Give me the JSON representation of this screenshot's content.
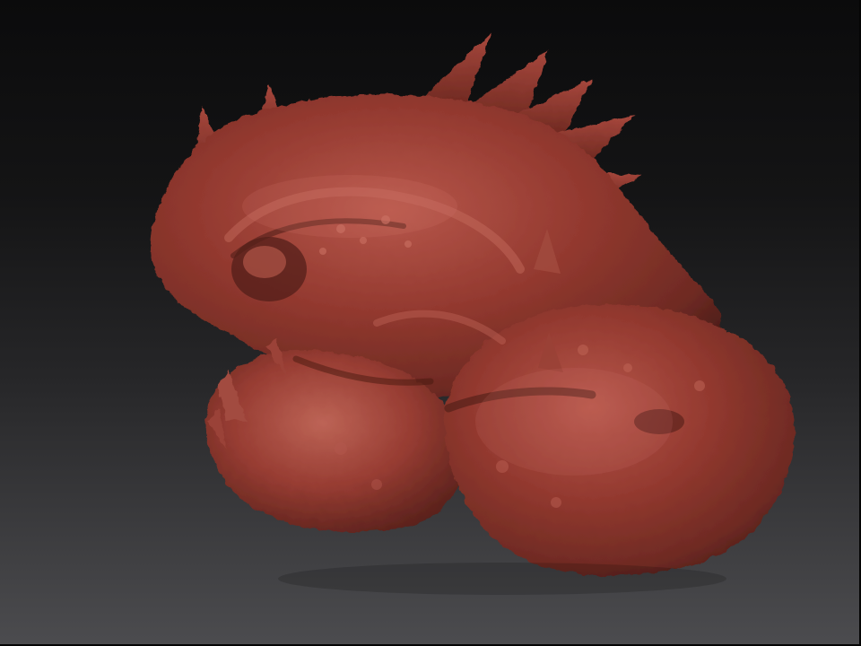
{
  "viewport": {
    "background_top": "#0b0b0c",
    "background_bottom": "#4c4c4f"
  },
  "model": {
    "subject": "sculpted-creature-head",
    "material_color": "#8e3a32",
    "highlight_color": "#c2675c",
    "shadow_color": "#3e1713"
  }
}
